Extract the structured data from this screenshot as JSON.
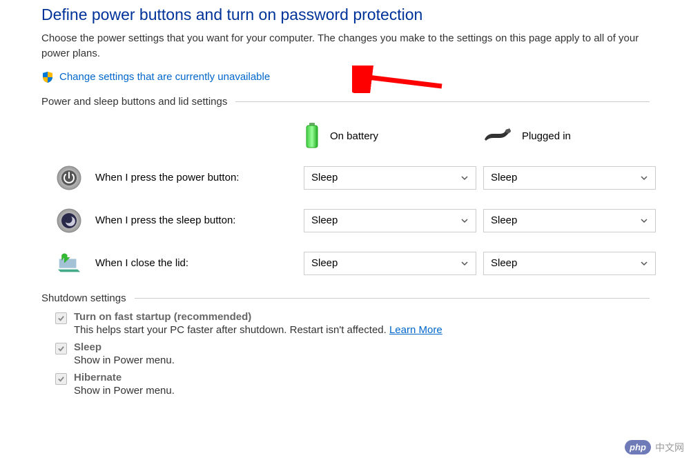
{
  "title": "Define power buttons and turn on password protection",
  "description": "Choose the power settings that you want for your computer. The changes you make to the settings on this page apply to all of your power plans.",
  "change_link": "Change settings that are currently unavailable",
  "section_buttons_lid": "Power and sleep buttons and lid settings",
  "columns": {
    "battery": "On battery",
    "plugged": "Plugged in"
  },
  "rows": {
    "power": {
      "label": "When I press the power button:",
      "battery_value": "Sleep",
      "plugged_value": "Sleep"
    },
    "sleep": {
      "label": "When I press the sleep button:",
      "battery_value": "Sleep",
      "plugged_value": "Sleep"
    },
    "lid": {
      "label": "When I close the lid:",
      "battery_value": "Sleep",
      "plugged_value": "Sleep"
    }
  },
  "section_shutdown": "Shutdown settings",
  "shutdown": {
    "fast_startup": {
      "title": "Turn on fast startup (recommended)",
      "desc": "This helps start your PC faster after shutdown. Restart isn't affected. ",
      "learn_more": "Learn More"
    },
    "sleep": {
      "title": "Sleep",
      "desc": "Show in Power menu."
    },
    "hibernate": {
      "title": "Hibernate",
      "desc": "Show in Power menu."
    }
  },
  "watermark": {
    "badge": "php",
    "text": "中文网"
  }
}
